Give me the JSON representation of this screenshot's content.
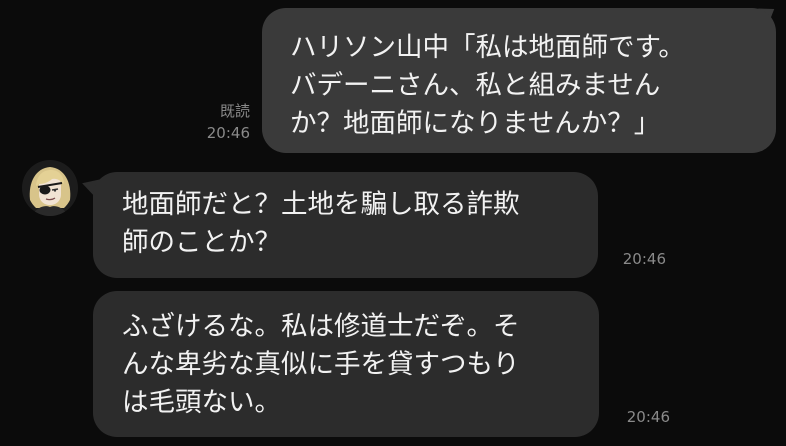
{
  "chat": {
    "messages": [
      {
        "side": "out",
        "text": "ハリソン山中「私は地面師です。\nバデーニさん、私と組みません\nか？地面師になりませんか？」",
        "read": "既読",
        "time": "20:46"
      },
      {
        "side": "in",
        "text": "地面師だと？土地を騙し取る詐欺\n師のことか？",
        "time": "20:46"
      },
      {
        "side": "in",
        "text": "ふざけるな。私は修道士だぞ。そ\nんな卑劣な真似に手を貸すつもり\nは毛頭ない。",
        "time": "20:46"
      }
    ],
    "colors": {
      "background": "#0b0b0b",
      "bubble_out": "#3a3a3a",
      "bubble_in": "#2c2c2c",
      "text": "#f2f2f2",
      "meta": "#8a8a8a"
    },
    "avatar_icon": "blonde-eyepatch-character-avatar-icon"
  }
}
